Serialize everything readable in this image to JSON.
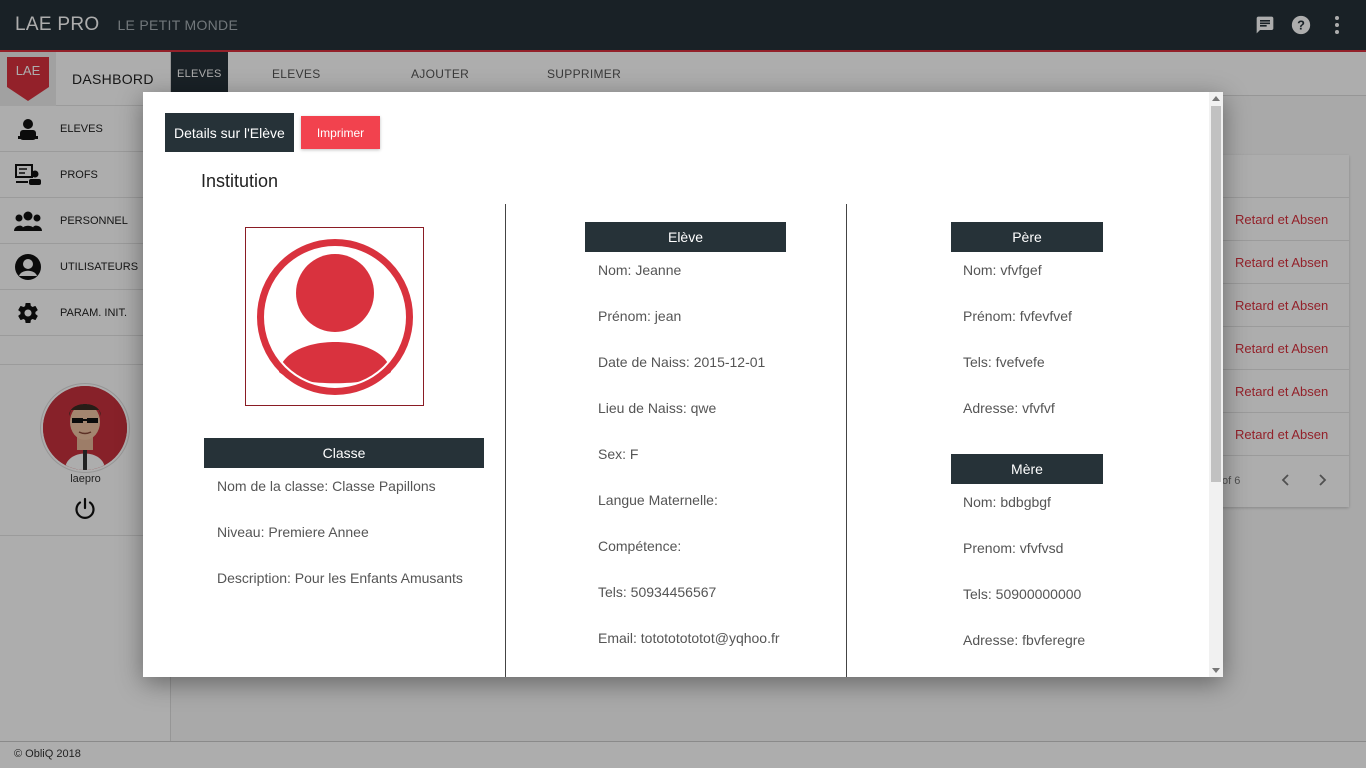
{
  "app": {
    "brand": "LAE PRO",
    "subtitle": "LE PETIT MONDE"
  },
  "topbar_icons": [
    "chat-icon",
    "help-icon",
    "more-vert-icon"
  ],
  "sidebar": {
    "logo_text": "LAE",
    "dashboard_label": "DASHBORD",
    "items": [
      {
        "label": "ELEVES",
        "icon": "student-icon"
      },
      {
        "label": "PROFS",
        "icon": "teacher-icon"
      },
      {
        "label": "PERSONNEL",
        "icon": "group-icon"
      },
      {
        "label": "UTILISATEURS",
        "icon": "user-circle-icon"
      },
      {
        "label": "PARAM. INIT.",
        "icon": "gear-icon"
      }
    ],
    "username": "laepro"
  },
  "tabs": {
    "active": "ELEVES",
    "items": [
      "ELEVES",
      "AJOUTER",
      "SUPPRIMER"
    ]
  },
  "background_list": {
    "rows": [
      "Retard et Absen",
      "Retard et Absen",
      "Retard et Absen",
      "Retard et Absen",
      "Retard et Absen",
      "Retard et Absen"
    ],
    "pager": "of 6"
  },
  "footer": "© ObliQ 2018",
  "modal": {
    "title": "Details sur l'Elève",
    "print_label": "Imprimer",
    "institution": "Institution",
    "classe": {
      "header": "Classe",
      "nom": "Nom de la classe: Classe Papillons",
      "niveau": "Niveau: Premiere Annee",
      "description": "Description: Pour les Enfants Amusants"
    },
    "eleve": {
      "header": "Elève",
      "nom": "Nom: Jeanne",
      "prenom": "Prénom: jean",
      "date_naiss": "Date de Naiss: 2015-12-01",
      "lieu_naiss": "Lieu de Naiss: qwe",
      "sex": "Sex: F",
      "langue": "Langue Maternelle:",
      "competence": "Compétence:",
      "tels": "Tels: 50934456567",
      "email": "Email: totototototot@yqhoo.fr"
    },
    "pere": {
      "header": "Père",
      "nom": "Nom: vfvfgef",
      "prenom": "Prénom: fvfevfvef",
      "tels": "Tels: fvefvefe",
      "adresse": "Adresse: vfvfvf"
    },
    "mere": {
      "header": "Mère",
      "nom": "Nom: bdbgbgf",
      "prenom": "Prenom: vfvfvsd",
      "tels": "Tels: 50900000000",
      "adresse": "Adresse: fbvferegre"
    }
  },
  "colors": {
    "dark": "#263238",
    "accent": "#d9323e",
    "button": "#f2424e"
  }
}
